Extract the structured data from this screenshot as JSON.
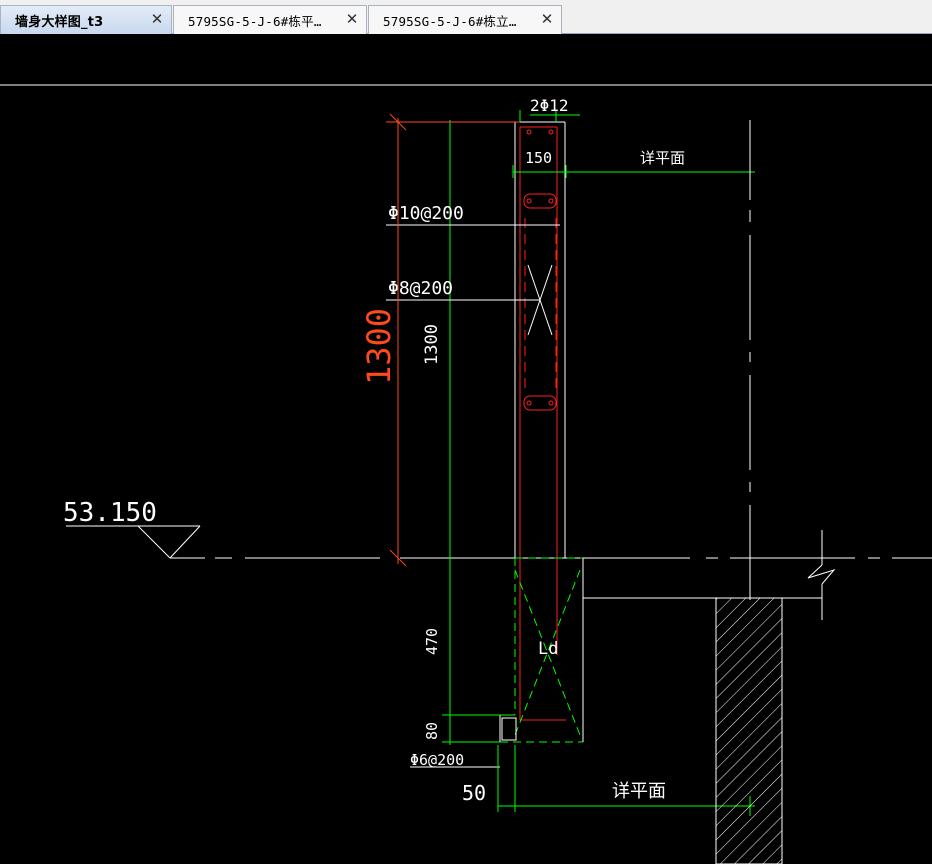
{
  "tabs": [
    {
      "label": "墙身大样图_t3",
      "active": true
    },
    {
      "label": "5795SG-5-J-6#栋平…",
      "active": false
    },
    {
      "label": "5795SG-5-J-6#栋立…",
      "active": false
    }
  ],
  "tab_close_glyph": "✕",
  "drawing": {
    "top_rebar": "2Φ12",
    "wall_width": "150",
    "see_plan_top": "详平面",
    "stirrup_1": "Φ10@200",
    "stirrup_2": "Φ8@200",
    "height_red": "1300",
    "height_white": "1300",
    "elevation": "53.150",
    "below_height": "470",
    "anchor": "Ld",
    "step_height": "80",
    "stirrup_3": "Φ6@200",
    "offset": "50",
    "see_plan_bottom": "详平面"
  },
  "colors": {
    "background": "#000000",
    "green": "#00ff00",
    "red": "#ff0000",
    "orange_red": "#ff4a1a",
    "white": "#ffffff"
  }
}
